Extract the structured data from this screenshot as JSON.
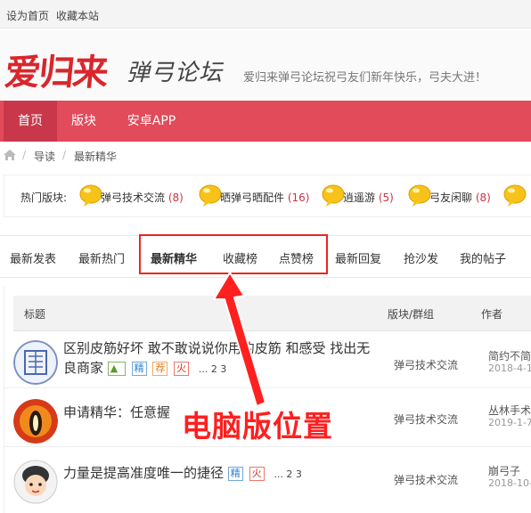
{
  "topbar": {
    "set_home": "设为首页",
    "bookmark": "收藏本站"
  },
  "header": {
    "logo_main": "爱归来",
    "logo_sub": "弹弓论坛",
    "slogan": "爱归来弹弓论坛祝弓友们新年快乐，弓夫大进！"
  },
  "nav": {
    "items": [
      {
        "label": "首页"
      },
      {
        "label": "版块"
      },
      {
        "label": "安卓APP"
      }
    ]
  },
  "breadcrumb": {
    "items": [
      "导读",
      "最新精华"
    ]
  },
  "hot": {
    "label": "热门版块:",
    "items": [
      {
        "name": "弹弓技术交流",
        "count": "(8)"
      },
      {
        "name": "晒弹弓晒配件",
        "count": "(16)"
      },
      {
        "name": "逍遥游",
        "count": "(5)"
      },
      {
        "name": "弓友闲聊",
        "count": "(8)"
      }
    ]
  },
  "tabs": {
    "items": [
      {
        "label": "最新发表"
      },
      {
        "label": "最新热门"
      },
      {
        "label": "最新精华"
      },
      {
        "label": "收藏榜"
      },
      {
        "label": "点赞榜"
      },
      {
        "label": "最新回复"
      },
      {
        "label": "抢沙发"
      },
      {
        "label": "我的帖子"
      }
    ]
  },
  "table": {
    "headers": {
      "title": "标题",
      "forum": "版块/群组",
      "author": "作者"
    },
    "rows": [
      {
        "title": "区别皮筋好坏 敢不敢说说你用的皮筋 和感受 找出无良商家",
        "tags": [
          "精",
          "荐",
          "火"
        ],
        "pages": "... 2  3",
        "forum": "弹弓技术交流",
        "author": "简约不简",
        "date": "2018-4-1"
      },
      {
        "title": "申请精华：任意握",
        "tags": [],
        "pages": "",
        "forum": "弹弓技术交流",
        "author": "丛林手术",
        "date": "2019-1-7"
      },
      {
        "title": "力量是提高准度唯一的捷径",
        "tags": [
          "精",
          "火"
        ],
        "pages": "... 2  3",
        "forum": "弹弓技术交流",
        "author": "崩弓子",
        "date": "2018-10-"
      }
    ]
  },
  "annotation": {
    "text": "电脑版位置"
  },
  "colors": {
    "nav_bg": "#e14b5a",
    "nav_active": "#c8384a",
    "highlight": "#e8271f",
    "logo": "#d9262c"
  }
}
